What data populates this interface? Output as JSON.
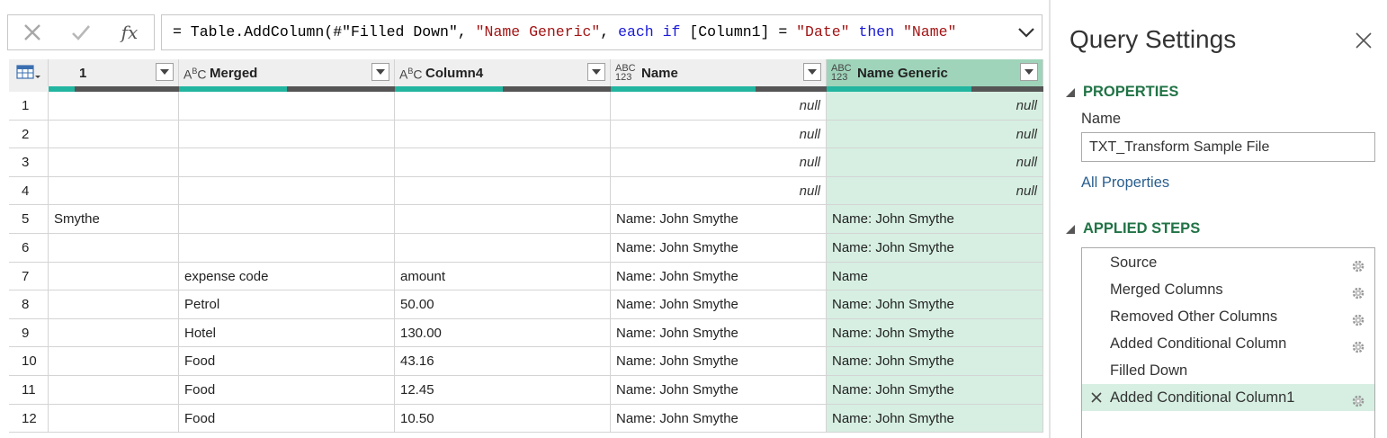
{
  "formula_bar": {
    "cancel_icon": "close-x-icon",
    "confirm_icon": "checkmark-icon",
    "fx_label": "fx",
    "parts": [
      {
        "t": "= Table.AddColumn(#\"Filled Down\", ",
        "c": "plain"
      },
      {
        "t": "\"Name Generic\"",
        "c": "str"
      },
      {
        "t": ", ",
        "c": "plain"
      },
      {
        "t": "each",
        "c": "kw"
      },
      {
        "t": " ",
        "c": "plain"
      },
      {
        "t": "if",
        "c": "kw"
      },
      {
        "t": " [Column1] = ",
        "c": "plain"
      },
      {
        "t": "\"Date\"",
        "c": "str"
      },
      {
        "t": " ",
        "c": "plain"
      },
      {
        "t": "then",
        "c": "kw"
      },
      {
        "t": " ",
        "c": "plain"
      },
      {
        "t": "\"Name\"",
        "c": "str"
      }
    ]
  },
  "grid": {
    "columns": [
      {
        "type": "",
        "name": "1",
        "quality": 0.2
      },
      {
        "type": "ABC",
        "name": "Merged",
        "quality": 0.5
      },
      {
        "type": "ABC",
        "name": "Column4",
        "quality": 0.5
      },
      {
        "type": "ABC123",
        "name": "Name",
        "quality": 0.67
      },
      {
        "type": "ABC123",
        "name": "Name Generic",
        "quality": 0.67,
        "selected": true
      }
    ],
    "rows": [
      {
        "n": "1",
        "c": [
          "",
          "",
          "",
          "null",
          "null"
        ]
      },
      {
        "n": "2",
        "c": [
          "",
          "",
          "",
          "null",
          "null"
        ]
      },
      {
        "n": "3",
        "c": [
          "",
          "",
          "",
          "null",
          "null"
        ]
      },
      {
        "n": "4",
        "c": [
          "",
          "",
          "",
          "null",
          "null"
        ]
      },
      {
        "n": "5",
        "c": [
          "Smythe",
          "",
          "",
          "Name: John Smythe",
          "Name: John Smythe"
        ]
      },
      {
        "n": "6",
        "c": [
          "",
          "",
          "",
          "Name: John Smythe",
          "Name: John Smythe"
        ]
      },
      {
        "n": "7",
        "c": [
          "",
          "expense code",
          "amount",
          "Name: John Smythe",
          "Name"
        ]
      },
      {
        "n": "8",
        "c": [
          "",
          "Petrol",
          "50.00",
          "Name: John Smythe",
          "Name: John Smythe"
        ]
      },
      {
        "n": "9",
        "c": [
          "",
          "Hotel",
          "130.00",
          "Name: John Smythe",
          "Name: John Smythe"
        ]
      },
      {
        "n": "10",
        "c": [
          "",
          "Food",
          "43.16",
          "Name: John Smythe",
          "Name: John Smythe"
        ]
      },
      {
        "n": "11",
        "c": [
          "",
          "Food",
          "12.45",
          "Name: John Smythe",
          "Name: John Smythe"
        ]
      },
      {
        "n": "12",
        "c": [
          "",
          "Food",
          "10.50",
          "Name: John Smythe",
          "Name: John Smythe"
        ]
      }
    ]
  },
  "query_settings": {
    "title": "Query Settings",
    "properties_heading": "PROPERTIES",
    "name_label": "Name",
    "name_value": "TXT_Transform Sample File",
    "all_properties_link": "All Properties",
    "applied_steps_heading": "APPLIED STEPS",
    "steps": [
      {
        "label": "Source",
        "gear": true
      },
      {
        "label": "Merged Columns",
        "gear": true
      },
      {
        "label": "Removed Other Columns",
        "gear": true
      },
      {
        "label": "Added Conditional Column",
        "gear": true
      },
      {
        "label": "Filled Down",
        "gear": false
      },
      {
        "label": "Added Conditional Column1",
        "gear": true,
        "active": true
      }
    ]
  },
  "colors": {
    "accent_green": "#217346",
    "selected_column": "#d6efe2",
    "quality_bar": "#22b5a0"
  }
}
